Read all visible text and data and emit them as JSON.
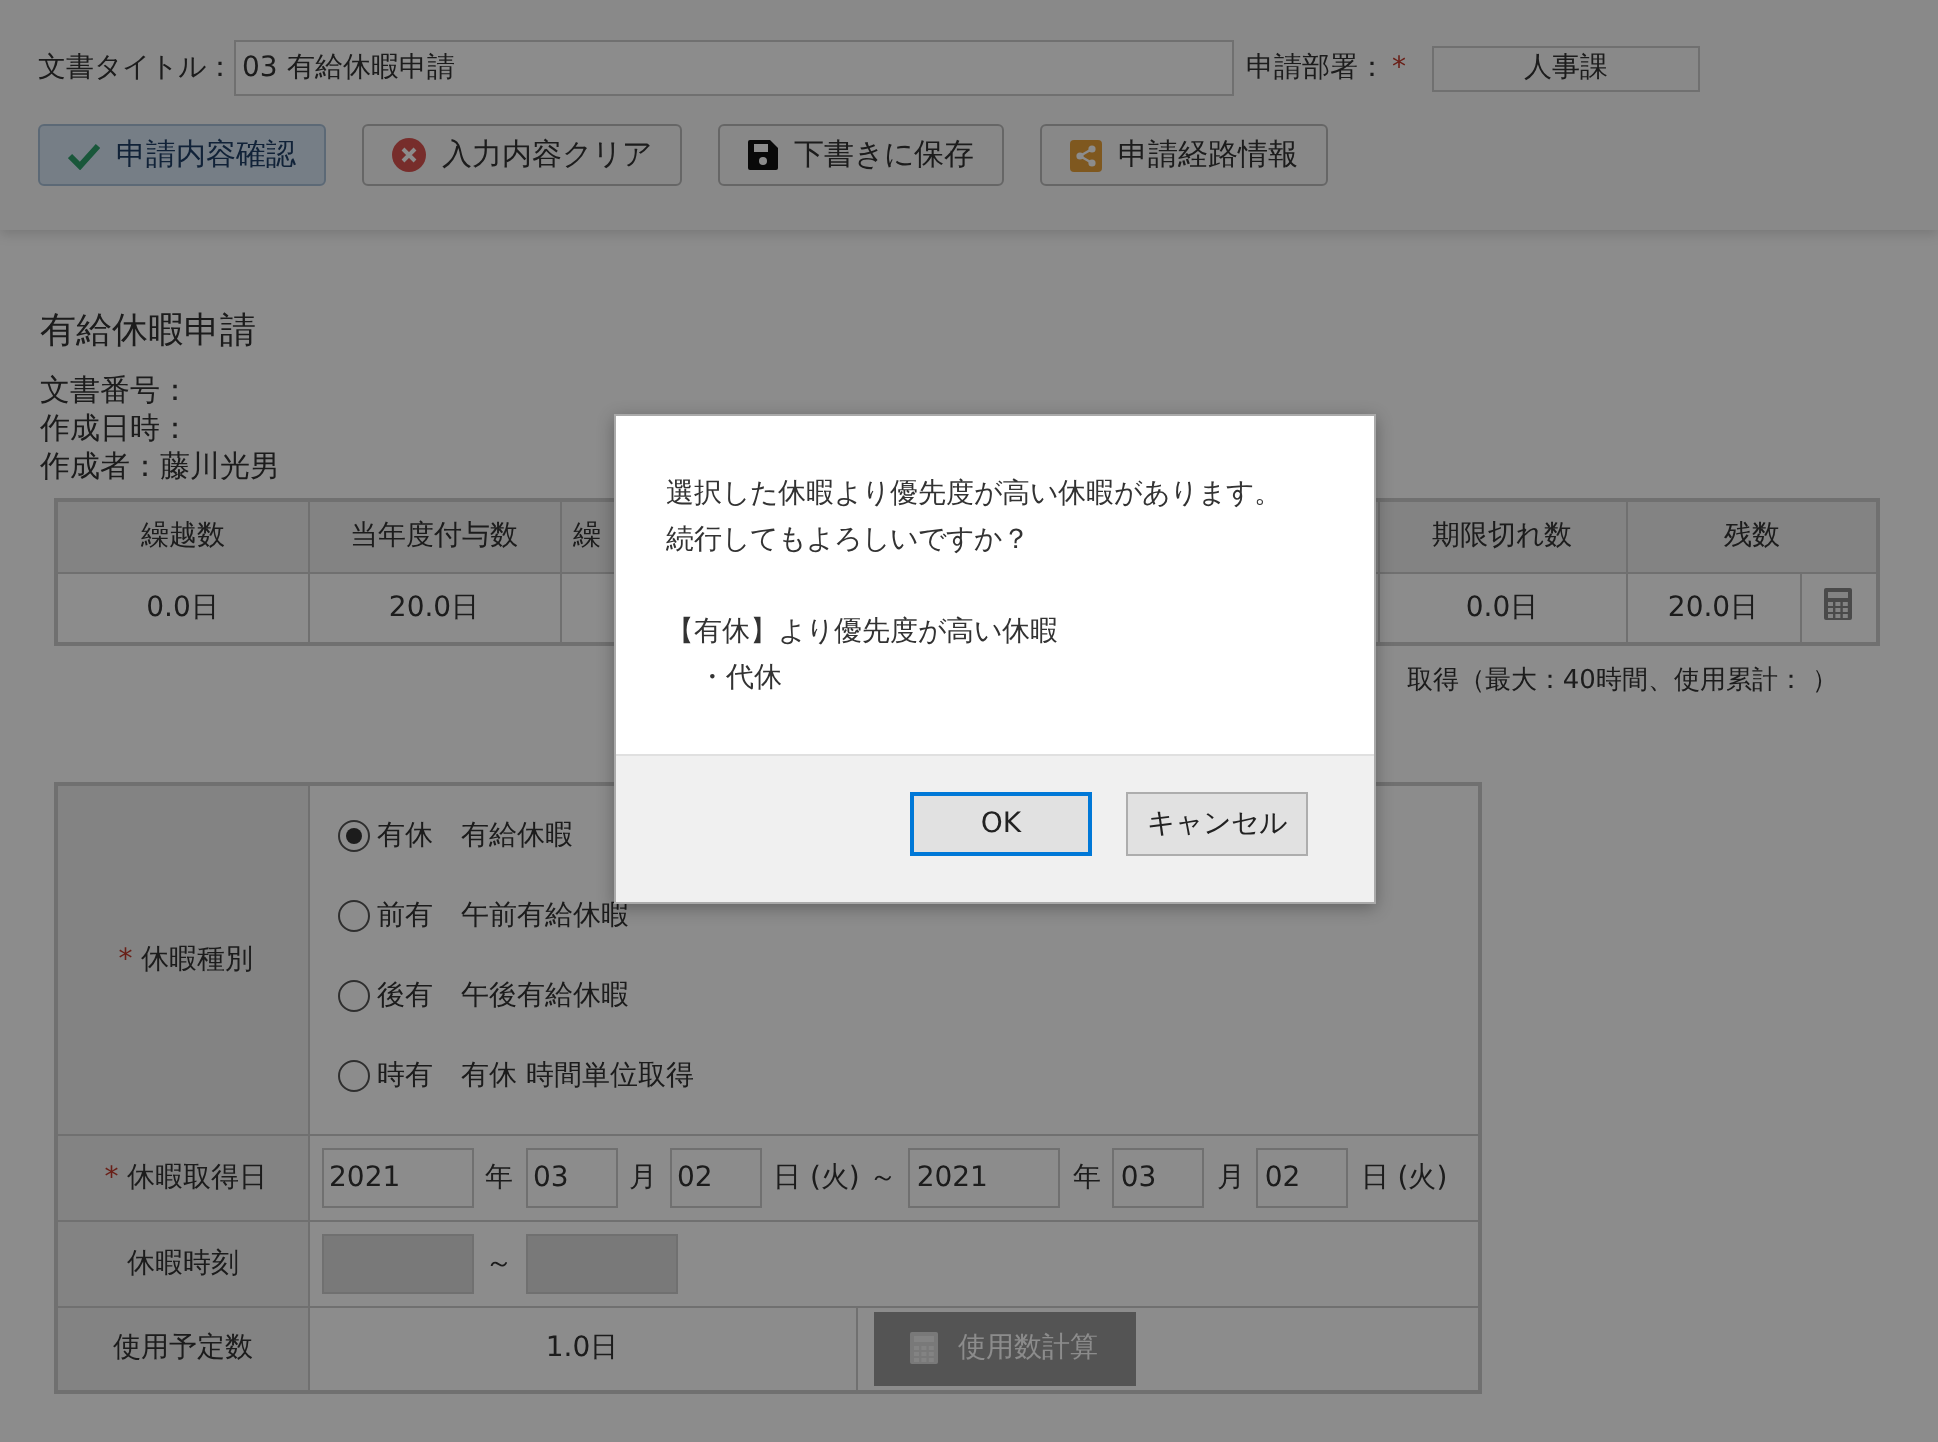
{
  "header": {
    "title_label": "文書タイトル：",
    "title_value": "03 有給休暇申請",
    "dept_label": "申請部署：",
    "dept_required_mark": "*",
    "dept_value": "人事課",
    "buttons": [
      {
        "label": "申請内容確認",
        "kind": "confirm"
      },
      {
        "label": "入力内容クリア",
        "kind": "clear"
      },
      {
        "label": "下書きに保存",
        "kind": "save"
      },
      {
        "label": "申請経路情報",
        "kind": "route"
      }
    ]
  },
  "form_title": "有給休暇申請",
  "meta": [
    "文書番号：",
    "作成日時：",
    "作成者：藤川光男"
  ],
  "balance": {
    "columns": [
      {
        "label": "繰越数",
        "value": "0.0日"
      },
      {
        "label": "当年度付与数",
        "value": "20.0日"
      },
      {
        "label": "繰"
      },
      {
        "label": "期限切れ数",
        "value": "0.0日"
      },
      {
        "label": "残数",
        "value": "20.0日"
      }
    ],
    "note": "取得（最大：40時間、使用累計： ）"
  },
  "leave_form": {
    "rows": [
      {
        "kind": "radios",
        "label": "休暇種別",
        "required_mark": "*",
        "options": [
          {
            "code": "有休",
            "name": "有給休暇",
            "selected": true
          },
          {
            "code": "前有",
            "name": "午前有給休暇",
            "selected": false
          },
          {
            "code": "後有",
            "name": "午後有給休暇",
            "selected": false
          },
          {
            "code": "時有",
            "name": "有休 時間単位取得",
            "selected": false
          }
        ]
      },
      {
        "kind": "inputs",
        "label": "休暇取得日",
        "required_mark": "*",
        "items": [
          {
            "kind": "year",
            "value": "2021"
          },
          {
            "kind": "unit",
            "text": "年"
          },
          {
            "kind": "month",
            "value": "03"
          },
          {
            "kind": "unit",
            "text": "月"
          },
          {
            "kind": "day",
            "value": "02"
          },
          {
            "kind": "unit",
            "text": "日 (火) ～"
          },
          {
            "kind": "year",
            "value": "2021"
          },
          {
            "kind": "unit",
            "text": "年"
          },
          {
            "kind": "month",
            "value": "03"
          },
          {
            "kind": "unit",
            "text": "月"
          },
          {
            "kind": "day",
            "value": "02"
          },
          {
            "kind": "unit",
            "text": "日 (火)"
          }
        ]
      },
      {
        "kind": "inputs",
        "label": "休暇時刻",
        "items": [
          {
            "kind": "time",
            "disabled": true
          },
          {
            "kind": "unit",
            "text": "～"
          },
          {
            "kind": "time",
            "disabled": true
          }
        ]
      },
      {
        "kind": "usage",
        "label": "使用予定数",
        "value": "1.0日",
        "button": {
          "label": "使用数計算",
          "disabled": true
        }
      }
    ]
  },
  "dialog": {
    "lines": [
      "選択した休暇より優先度が高い休暇があります。",
      "続行してもよろしいですか？"
    ],
    "sub_lines": [
      "【有休】より優先度が高い休暇",
      "・代休"
    ],
    "buttons": [
      {
        "label": "OK",
        "focused": true
      },
      {
        "label": "キャンセル",
        "focused": false
      }
    ]
  }
}
